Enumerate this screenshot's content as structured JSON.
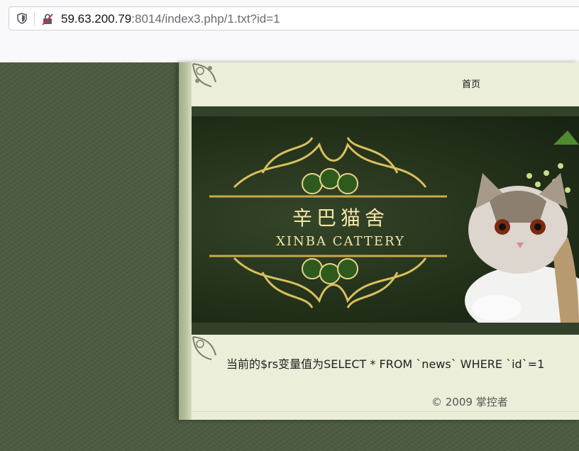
{
  "browser": {
    "url_host": "59.63.200.79",
    "url_rest": ":8014/index3.php/1.txt?id=1"
  },
  "site": {
    "nav_home": "首页",
    "logo_cn": "辛巴猫舍",
    "logo_en": "XINBA CATTERY",
    "content": "当前的$rs变量值为SELECT * FROM `news` WHERE `id`=1",
    "footer": "© 2009 掌控者"
  },
  "colors": {
    "background": "#4c5b41",
    "page": "#ebeed8",
    "banner": "#223019",
    "gold": "#f3e6a8"
  }
}
